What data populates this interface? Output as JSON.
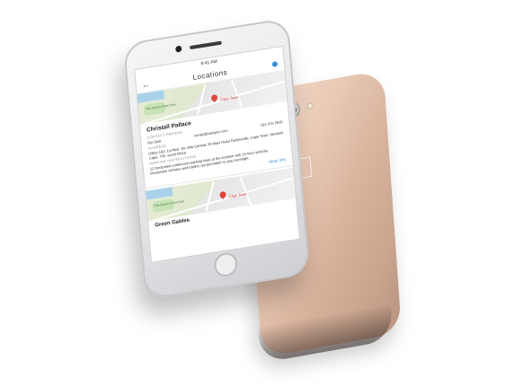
{
  "status_bar": {
    "time": "9:41 AM"
  },
  "header": {
    "title": "Locations"
  },
  "locations": [
    {
      "name": "Christall Pallace",
      "map": {
        "pin_label": "Cape Town",
        "poi": "The Green Point Park",
        "area": "Cape Town"
      },
      "contact_person_label": "CONTACT PERSON",
      "contact_name": "Rei Smit",
      "contact_email": "rsmart@webprix.com",
      "contact_phone": "021 975 2616",
      "address_label": "ADDRESS",
      "address": "Office 102, 1st floor, De Villa Central, 56 Main Road Durbanville, Cape Town, Western Cape, 755, south Africa",
      "parking_label": "PARKING INSTRUCTIONS",
      "parking": "12 Dedicated undercover parking bays at the location with 24 hour security. Production vehicles and trailers not permitted to stay overnight.",
      "more_info": "More Info"
    },
    {
      "name": "Green Gables",
      "map": {
        "pin_label": "Cape Town",
        "poi": "The Green Point Park",
        "area": "Cape Town"
      }
    }
  ],
  "colors": {
    "accent": "#2f8de4",
    "pin": "#e1453a",
    "back_phone": "#e9c9b4",
    "front_phone": "#e3e3e6"
  },
  "icons": {
    "back": "arrow-left-icon",
    "apple": "apple-logo-icon",
    "map_pin": "map-pin-icon"
  }
}
